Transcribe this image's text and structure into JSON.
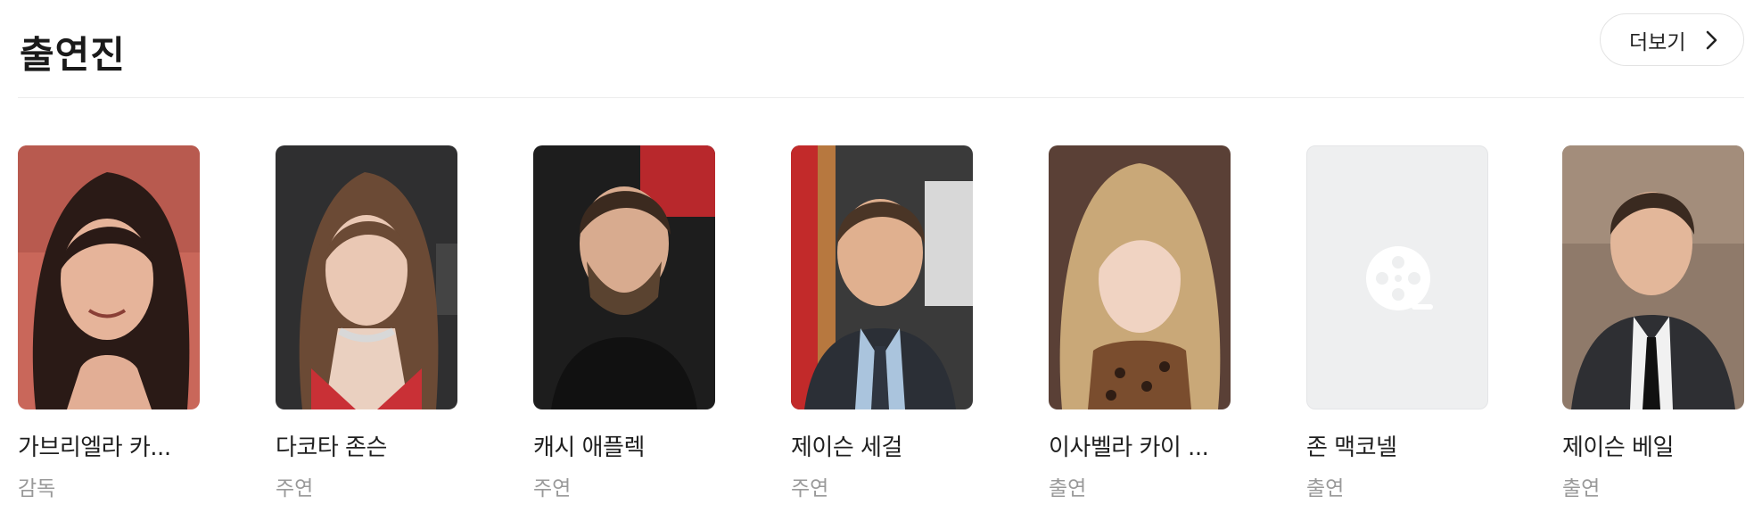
{
  "section": {
    "title": "출연진",
    "more_label": "더보기",
    "more_icon": "chevron-right-icon"
  },
  "cast": [
    {
      "name": "가브리엘라 카...",
      "role": "감독"
    },
    {
      "name": "다코타 존슨",
      "role": "주연"
    },
    {
      "name": "캐시 애플렉",
      "role": "주연"
    },
    {
      "name": "제이슨 세걸",
      "role": "주연"
    },
    {
      "name": "이사벨라 카이 ...",
      "role": "출연"
    },
    {
      "name": "존 맥코넬",
      "role": "출연"
    },
    {
      "name": "제이슨 베일",
      "role": "출연"
    }
  ],
  "placeholder_icon": "film-reel-icon"
}
